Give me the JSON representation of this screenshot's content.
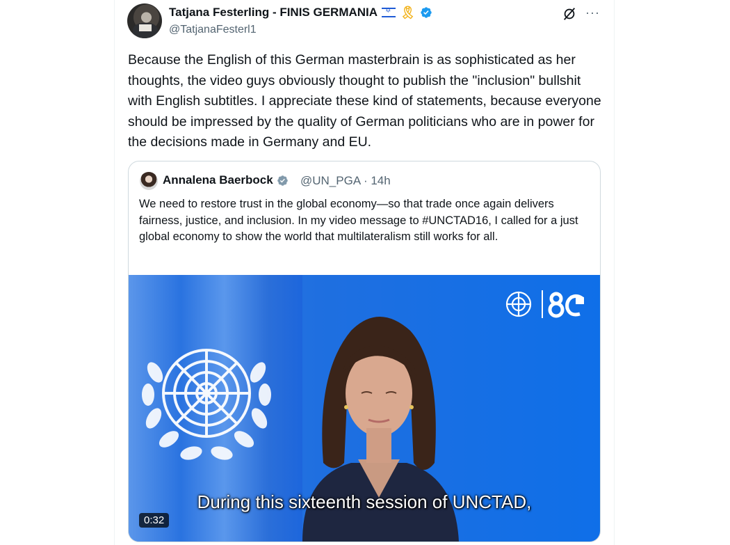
{
  "tweet": {
    "author_name": "Tatjana Festerling - FINIS GERMANIA",
    "handle": "@TatjanaFesterl1",
    "text": "Because the English of this German masterbrain is as sophisticated as her thoughts, the video guys obviously thought to publish the \"inclusion\" bullshit with English subtitles. I appreciate these kind of statements, because everyone should be impressed by the quality of German politicians who are in power for the decisions made in Germany and EU.",
    "more_label": "···"
  },
  "quoted": {
    "author_name": "Annalena Baerbock",
    "meta": "@UN_PGA · 14h",
    "text": "We need to restore trust in the global economy—so that trade once again delivers fairness, justice, and inclusion. In my video message to #UNCTAD16, I called for a just global economy to show the world that multilateralism still works for all.",
    "video": {
      "subtitle": "During this sixteenth session of UNCTAD,",
      "duration": "0:32"
    }
  },
  "colors": {
    "verified": "#1d9bf0",
    "un_blue": "#1f6fe0",
    "text_secondary": "#536471"
  },
  "icons": [
    "verified-badge-icon",
    "grok-icon",
    "more-icon",
    "yellow-ribbon-icon",
    "israel-flag-icon",
    "un-emblem-icon"
  ]
}
